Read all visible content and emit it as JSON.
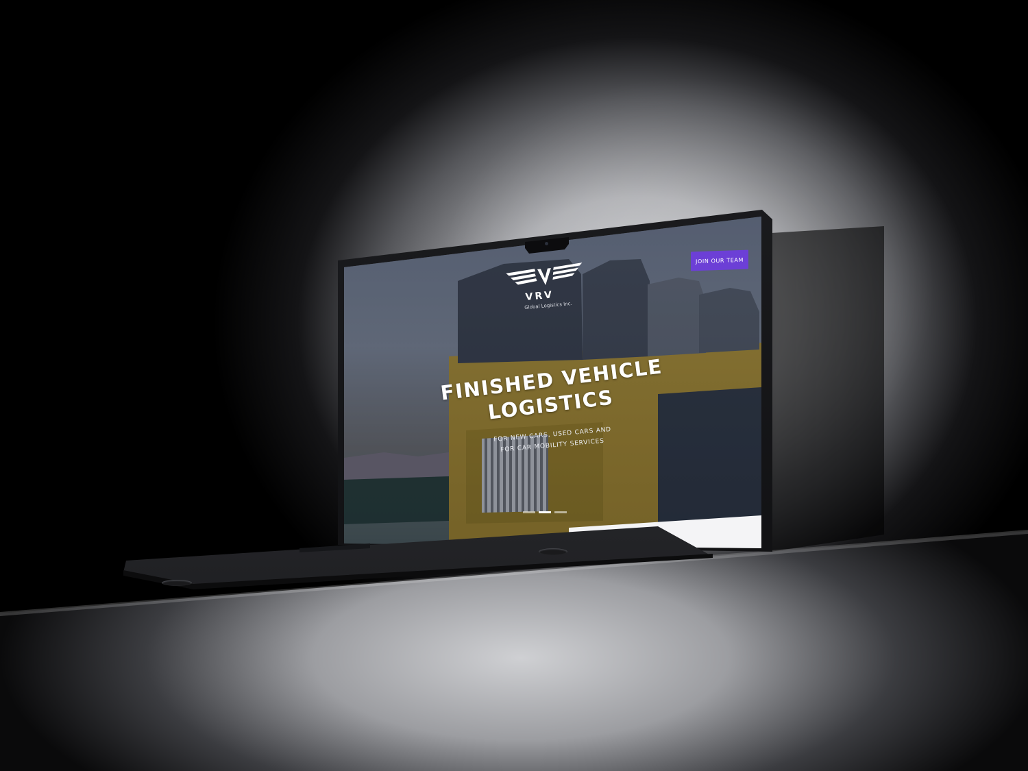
{
  "brand": {
    "name": "VRV",
    "tagline": "Global Logistics Inc."
  },
  "header": {
    "cta_label": "JOIN OUR TEAM"
  },
  "hero": {
    "title_line1": "FINISHED VEHICLE",
    "title_line2": "LOGISTICS",
    "subtitle_line1": "FOR NEW CARS, USED CARS AND",
    "subtitle_line2": "FOR CAR MOBILITY SERVICES",
    "slides": [
      {
        "active": false
      },
      {
        "active": true
      },
      {
        "active": false
      }
    ]
  },
  "colors": {
    "accent": "#6c3fd6",
    "hero_text": "#ffffff",
    "page_footer_band": "#f4f4f6"
  },
  "icons": {
    "logo": "winged-v-logo-icon"
  }
}
